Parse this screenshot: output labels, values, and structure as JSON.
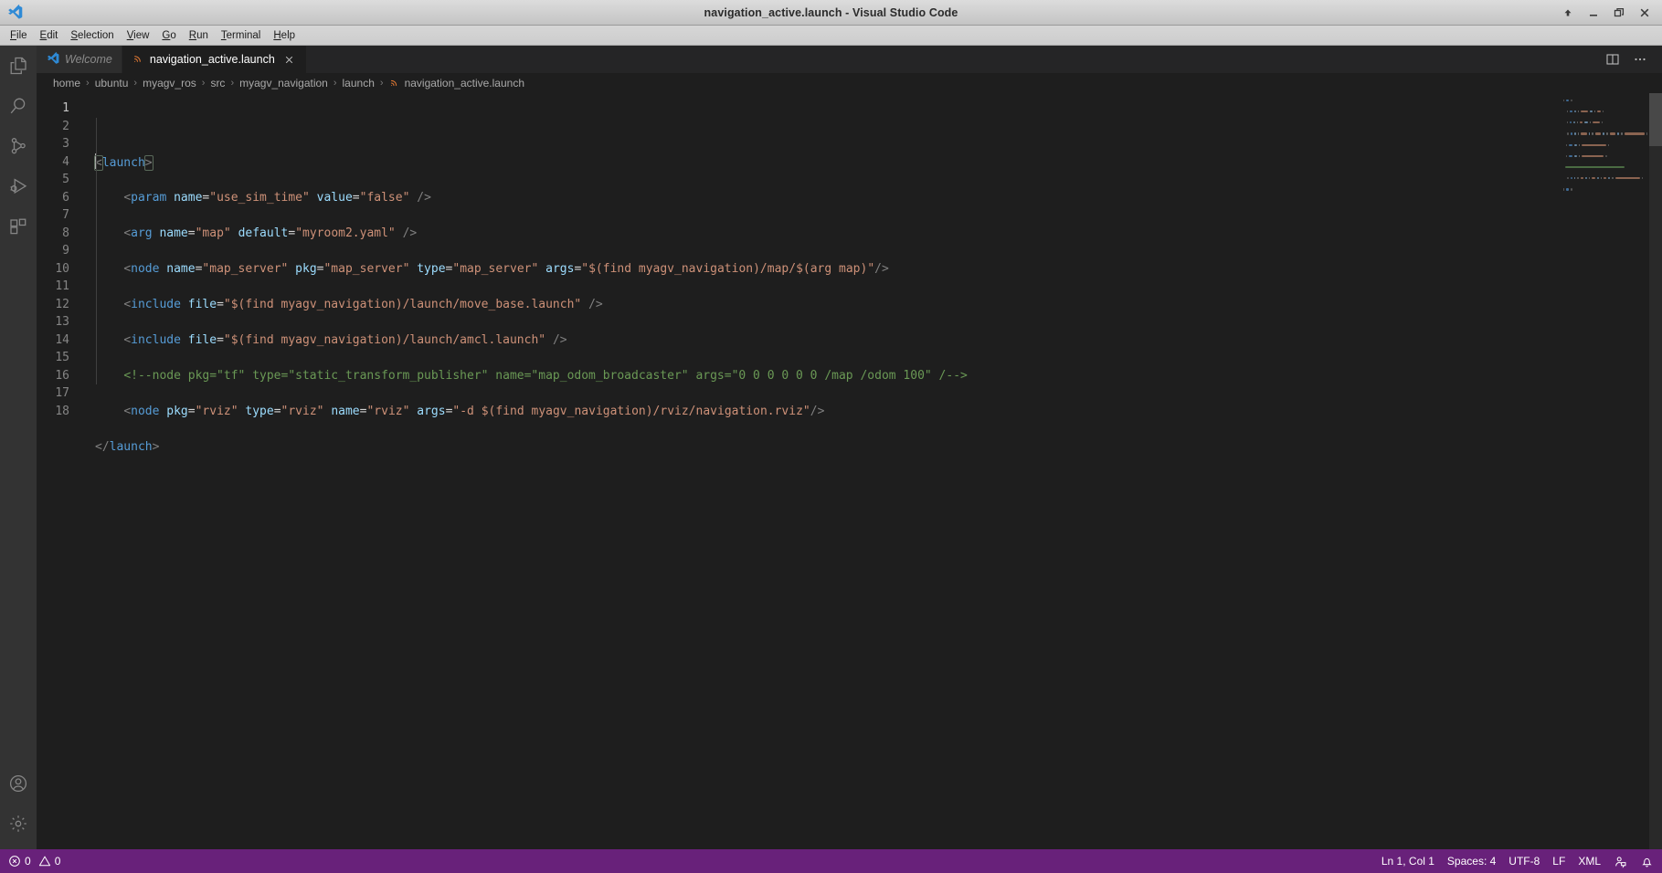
{
  "window": {
    "title": "navigation_active.launch - Visual Studio Code",
    "app_icon": "vscode-logo-icon",
    "controls": [
      {
        "name": "shade-window-button",
        "icon": "arrow-up-icon"
      },
      {
        "name": "minimize-window-button",
        "icon": "minimize-icon"
      },
      {
        "name": "maximize-window-button",
        "icon": "restore-icon"
      },
      {
        "name": "close-window-button",
        "icon": "close-icon"
      }
    ]
  },
  "menubar": {
    "items": [
      {
        "label": "File",
        "mnemonic": "F",
        "rest": "ile"
      },
      {
        "label": "Edit",
        "mnemonic": "E",
        "rest": "dit"
      },
      {
        "label": "Selection",
        "mnemonic": "S",
        "rest": "election"
      },
      {
        "label": "View",
        "mnemonic": "V",
        "rest": "iew"
      },
      {
        "label": "Go",
        "mnemonic": "G",
        "rest": "o"
      },
      {
        "label": "Run",
        "mnemonic": "R",
        "rest": "un"
      },
      {
        "label": "Terminal",
        "mnemonic": "T",
        "rest": "erminal"
      },
      {
        "label": "Help",
        "mnemonic": "H",
        "rest": "elp"
      }
    ]
  },
  "activitybar": {
    "top": [
      {
        "name": "sidebar-item-explorer",
        "icon": "files-icon",
        "title": "Explorer"
      },
      {
        "name": "sidebar-item-search",
        "icon": "search-icon",
        "title": "Search"
      },
      {
        "name": "sidebar-item-source-control",
        "icon": "source-control-icon",
        "title": "Source Control"
      },
      {
        "name": "sidebar-item-run-debug",
        "icon": "run-and-debug-icon",
        "title": "Run and Debug"
      },
      {
        "name": "sidebar-item-extensions",
        "icon": "extensions-icon",
        "title": "Extensions"
      }
    ],
    "bottom": [
      {
        "name": "accounts-button",
        "icon": "account-icon",
        "title": "Accounts"
      },
      {
        "name": "manage-settings-button",
        "icon": "gear-icon",
        "title": "Manage"
      }
    ]
  },
  "tabs": [
    {
      "label": "Welcome",
      "icon": "vscode-logo-icon",
      "active": false,
      "closable": false,
      "italic": true
    },
    {
      "label": "navigation_active.launch",
      "icon": "xml-file-icon",
      "active": true,
      "closable": true,
      "italic": false
    }
  ],
  "editor_actions": [
    {
      "name": "split-editor-right-button",
      "icon": "split-editor-icon"
    },
    {
      "name": "more-actions-button",
      "icon": "ellipsis-icon"
    }
  ],
  "breadcrumb": {
    "separator": "›",
    "segments": [
      {
        "label": "home",
        "icon": ""
      },
      {
        "label": "ubuntu",
        "icon": ""
      },
      {
        "label": "myagv_ros",
        "icon": ""
      },
      {
        "label": "src",
        "icon": ""
      },
      {
        "label": "myagv_navigation",
        "icon": ""
      },
      {
        "label": "launch",
        "icon": ""
      },
      {
        "label": "navigation_active.launch",
        "icon": "xml-file-icon"
      }
    ]
  },
  "editor": {
    "filename": "navigation_active.launch",
    "language": "XML",
    "line_count": 18,
    "active_line": 1,
    "lines": [
      {
        "n": 1,
        "tokens": [
          {
            "t": "bracket-open",
            "v": "<"
          },
          {
            "t": "tag",
            "v": "launch"
          },
          {
            "t": "bracket-close",
            "v": ">"
          }
        ]
      },
      {
        "n": 2,
        "tokens": []
      },
      {
        "n": 3,
        "tokens": [
          {
            "t": "plain",
            "v": "    "
          },
          {
            "t": "bracket",
            "v": "<"
          },
          {
            "t": "tag",
            "v": "param"
          },
          {
            "t": "plain",
            "v": " "
          },
          {
            "t": "attr",
            "v": "name"
          },
          {
            "t": "eq",
            "v": "="
          },
          {
            "t": "str",
            "v": "\"use_sim_time\""
          },
          {
            "t": "plain",
            "v": " "
          },
          {
            "t": "attr",
            "v": "value"
          },
          {
            "t": "eq",
            "v": "="
          },
          {
            "t": "str",
            "v": "\"false\""
          },
          {
            "t": "plain",
            "v": " "
          },
          {
            "t": "bracket",
            "v": "/>"
          }
        ]
      },
      {
        "n": 4,
        "tokens": []
      },
      {
        "n": 5,
        "tokens": [
          {
            "t": "plain",
            "v": "    "
          },
          {
            "t": "bracket",
            "v": "<"
          },
          {
            "t": "tag",
            "v": "arg"
          },
          {
            "t": "plain",
            "v": " "
          },
          {
            "t": "attr",
            "v": "name"
          },
          {
            "t": "eq",
            "v": "="
          },
          {
            "t": "str",
            "v": "\"map\""
          },
          {
            "t": "plain",
            "v": " "
          },
          {
            "t": "attr",
            "v": "default"
          },
          {
            "t": "eq",
            "v": "="
          },
          {
            "t": "str",
            "v": "\"myroom2.yaml\""
          },
          {
            "t": "plain",
            "v": " "
          },
          {
            "t": "bracket",
            "v": "/>"
          }
        ]
      },
      {
        "n": 6,
        "tokens": []
      },
      {
        "n": 7,
        "tokens": [
          {
            "t": "plain",
            "v": "    "
          },
          {
            "t": "bracket",
            "v": "<"
          },
          {
            "t": "tag",
            "v": "node"
          },
          {
            "t": "plain",
            "v": " "
          },
          {
            "t": "attr",
            "v": "name"
          },
          {
            "t": "eq",
            "v": "="
          },
          {
            "t": "str",
            "v": "\"map_server\""
          },
          {
            "t": "plain",
            "v": " "
          },
          {
            "t": "attr",
            "v": "pkg"
          },
          {
            "t": "eq",
            "v": "="
          },
          {
            "t": "str",
            "v": "\"map_server\""
          },
          {
            "t": "plain",
            "v": " "
          },
          {
            "t": "attr",
            "v": "type"
          },
          {
            "t": "eq",
            "v": "="
          },
          {
            "t": "str",
            "v": "\"map_server\""
          },
          {
            "t": "plain",
            "v": " "
          },
          {
            "t": "attr",
            "v": "args"
          },
          {
            "t": "eq",
            "v": "="
          },
          {
            "t": "str",
            "v": "\"$(find myagv_navigation)/map/$(arg map)\""
          },
          {
            "t": "bracket",
            "v": "/>"
          }
        ]
      },
      {
        "n": 8,
        "tokens": []
      },
      {
        "n": 9,
        "tokens": [
          {
            "t": "plain",
            "v": "    "
          },
          {
            "t": "bracket",
            "v": "<"
          },
          {
            "t": "tag",
            "v": "include"
          },
          {
            "t": "plain",
            "v": " "
          },
          {
            "t": "attr",
            "v": "file"
          },
          {
            "t": "eq",
            "v": "="
          },
          {
            "t": "str",
            "v": "\"$(find myagv_navigation)/launch/move_base.launch\""
          },
          {
            "t": "plain",
            "v": " "
          },
          {
            "t": "bracket",
            "v": "/>"
          }
        ]
      },
      {
        "n": 10,
        "tokens": []
      },
      {
        "n": 11,
        "tokens": [
          {
            "t": "plain",
            "v": "    "
          },
          {
            "t": "bracket",
            "v": "<"
          },
          {
            "t": "tag",
            "v": "include"
          },
          {
            "t": "plain",
            "v": " "
          },
          {
            "t": "attr",
            "v": "file"
          },
          {
            "t": "eq",
            "v": "="
          },
          {
            "t": "str",
            "v": "\"$(find myagv_navigation)/launch/amcl.launch\""
          },
          {
            "t": "plain",
            "v": " "
          },
          {
            "t": "bracket",
            "v": "/>"
          }
        ]
      },
      {
        "n": 12,
        "tokens": []
      },
      {
        "n": 13,
        "tokens": [
          {
            "t": "plain",
            "v": "    "
          },
          {
            "t": "comment",
            "v": "<!--node pkg=\"tf\" type=\"static_transform_publisher\" name=\"map_odom_broadcaster\" args=\"0 0 0 0 0 0 /map /odom 100\" /-->"
          }
        ]
      },
      {
        "n": 14,
        "tokens": []
      },
      {
        "n": 15,
        "tokens": [
          {
            "t": "plain",
            "v": "    "
          },
          {
            "t": "bracket",
            "v": "<"
          },
          {
            "t": "tag",
            "v": "node"
          },
          {
            "t": "plain",
            "v": " "
          },
          {
            "t": "attr",
            "v": "pkg"
          },
          {
            "t": "eq",
            "v": "="
          },
          {
            "t": "str",
            "v": "\"rviz\""
          },
          {
            "t": "plain",
            "v": " "
          },
          {
            "t": "attr",
            "v": "type"
          },
          {
            "t": "eq",
            "v": "="
          },
          {
            "t": "str",
            "v": "\"rviz\""
          },
          {
            "t": "plain",
            "v": " "
          },
          {
            "t": "attr",
            "v": "name"
          },
          {
            "t": "eq",
            "v": "="
          },
          {
            "t": "str",
            "v": "\"rviz\""
          },
          {
            "t": "plain",
            "v": " "
          },
          {
            "t": "attr",
            "v": "args"
          },
          {
            "t": "eq",
            "v": "="
          },
          {
            "t": "str",
            "v": "\"-d $(find myagv_navigation)/rviz/navigation.rviz\""
          },
          {
            "t": "bracket",
            "v": "/>"
          }
        ]
      },
      {
        "n": 16,
        "tokens": []
      },
      {
        "n": 17,
        "tokens": [
          {
            "t": "bracket",
            "v": "</"
          },
          {
            "t": "tag",
            "v": "launch"
          },
          {
            "t": "bracket",
            "v": ">"
          }
        ]
      },
      {
        "n": 18,
        "tokens": []
      }
    ]
  },
  "statusbar": {
    "left": [
      {
        "name": "problems-status",
        "icon": "error-icon",
        "label": "0",
        "icon2": "warning-icon",
        "label2": "0"
      }
    ],
    "right": [
      {
        "name": "editor-position-status",
        "label": "Ln 1, Col 1"
      },
      {
        "name": "editor-indentation-status",
        "label": "Spaces: 4"
      },
      {
        "name": "editor-encoding-status",
        "label": "UTF-8"
      },
      {
        "name": "editor-eol-status",
        "label": "LF"
      },
      {
        "name": "editor-language-status",
        "label": "XML"
      },
      {
        "name": "feedback-status",
        "icon": "feedback-person-icon",
        "label": ""
      },
      {
        "name": "notifications-status",
        "icon": "bell-icon",
        "label": ""
      }
    ]
  },
  "colors": {
    "statusbar_bg": "#68217a",
    "activitybar_bg": "#333333",
    "editor_bg": "#1e1e1e",
    "tab_active_bg": "#1e1e1e",
    "tab_inactive_bg": "#2d2d2d",
    "titlebar_bg": "#cfcfcf",
    "tag": "#569cd6",
    "attribute": "#9cdcfe",
    "string": "#ce9178",
    "comment": "#6a9955"
  }
}
